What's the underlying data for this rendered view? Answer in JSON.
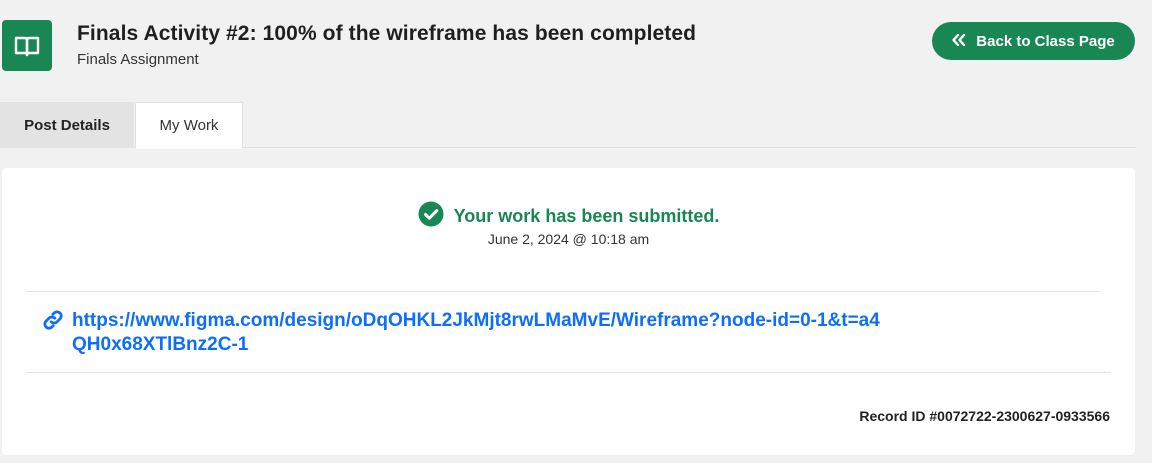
{
  "header": {
    "icon": "open-book-icon",
    "title": "Finals Activity #2: 100% of the wireframe has been completed",
    "subtitle": "Finals Assignment",
    "back_button": {
      "icon": "double-chevron-left-icon",
      "label": "Back to Class Page"
    }
  },
  "tabs": [
    {
      "label": "Post Details",
      "active": false
    },
    {
      "label": "My Work",
      "active": true
    }
  ],
  "submission": {
    "status_icon": "check-circle-icon",
    "status": "Your work has been submitted.",
    "date": "June 2, 2024 @ 10:18 am",
    "link_icon": "link-icon",
    "link": "https://www.figma.com/design/oDqOHKL2JkMjt8rwLMaMvE/Wireframe?node-id=0-1&t=a4QH0x68XTlBnz2C-1",
    "record_id": "Record ID #0072722-2300627-0933566"
  },
  "colors": {
    "brand_green": "#198754",
    "link_blue": "#0d6efd",
    "page_bg": "#f1f1f1"
  }
}
